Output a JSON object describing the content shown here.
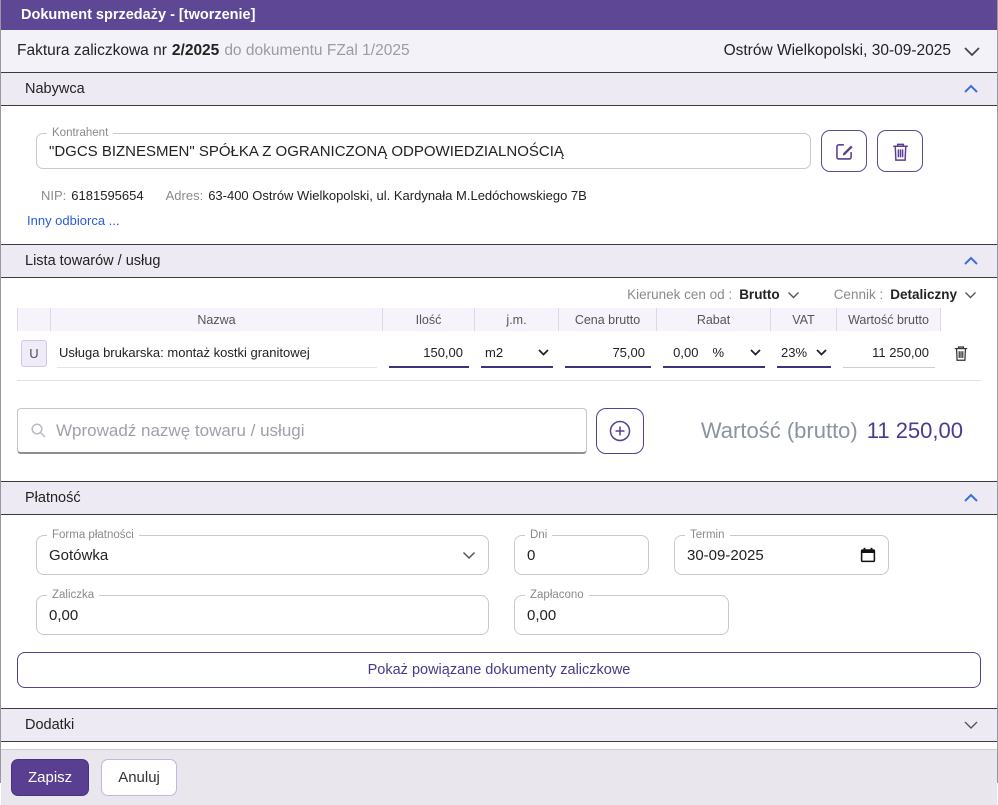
{
  "title_bar": {
    "title": "Dokument sprzedaży - [tworzenie]"
  },
  "doc_header": {
    "doc_type": "Faktura zaliczkowa nr",
    "doc_number": "2/2025",
    "doc_ref": "do dokumentu FZal 1/2025",
    "place_date": "Ostrów Wielkopolski, 30-09-2025"
  },
  "sections": {
    "buyer": {
      "title": "Nabywca"
    },
    "items": {
      "title": "Lista towarów / usług"
    },
    "payment": {
      "title": "Płatność"
    },
    "extras": {
      "title": "Dodatki"
    }
  },
  "buyer": {
    "contractor_label": "Kontrahent",
    "contractor_value": "\"DGCS BIZNESMEN\" SPÓŁKA Z OGRANICZONĄ ODPOWIEDZIALNOŚCIĄ",
    "nip_label": "NIP:",
    "nip_value": "6181595654",
    "address_label": "Adres:",
    "address_value": "63-400 Ostrów Wielkopolski, ul. Kardynała M.Ledóchowskiego 7B",
    "other_recipient_link": "Inny odbiorca ..."
  },
  "items": {
    "price_direction_label": "Kierunek cen od :",
    "price_direction_value": "Brutto",
    "price_list_label": "Cennik :",
    "price_list_value": "Detaliczny",
    "table": {
      "headers": [
        "",
        "Nazwa",
        "Ilość",
        "j.m.",
        "Cena brutto",
        "Rabat",
        "VAT",
        "Wartość brutto",
        ""
      ],
      "rows": [
        {
          "type_badge": "U",
          "name": "Usługa brukarska: montaż kostki granitowej",
          "quantity": "150,00",
          "unit": "m2",
          "gross_price": "75,00",
          "discount": "0,00",
          "discount_unit": "%",
          "vat": "23%",
          "gross_value": "11 250,00"
        }
      ]
    },
    "search_placeholder": "Wprowadź nazwę towaru / usługi",
    "total_label": "Wartość (brutto)",
    "total_value": "11 250,00"
  },
  "payment": {
    "form_label": "Forma płatności",
    "form_value": "Gotówka",
    "days_label": "Dni",
    "days_value": "0",
    "due_label": "Termin",
    "due_value": "30-09-2025",
    "advance_label": "Zaliczka",
    "advance_value": "0,00",
    "paid_label": "Zapłacono",
    "paid_value": "0,00",
    "related_docs_button": "Pokaż powiązane dokumenty zaliczkowe"
  },
  "footer": {
    "save_label": "Zapisz",
    "cancel_label": "Anuluj"
  },
  "colors": {
    "accent_purple": "#5e4795",
    "link_blue": "#2b5bd7",
    "chevron_blue": "#3a6fd8",
    "total_value_purple": "#4b3a8e"
  }
}
